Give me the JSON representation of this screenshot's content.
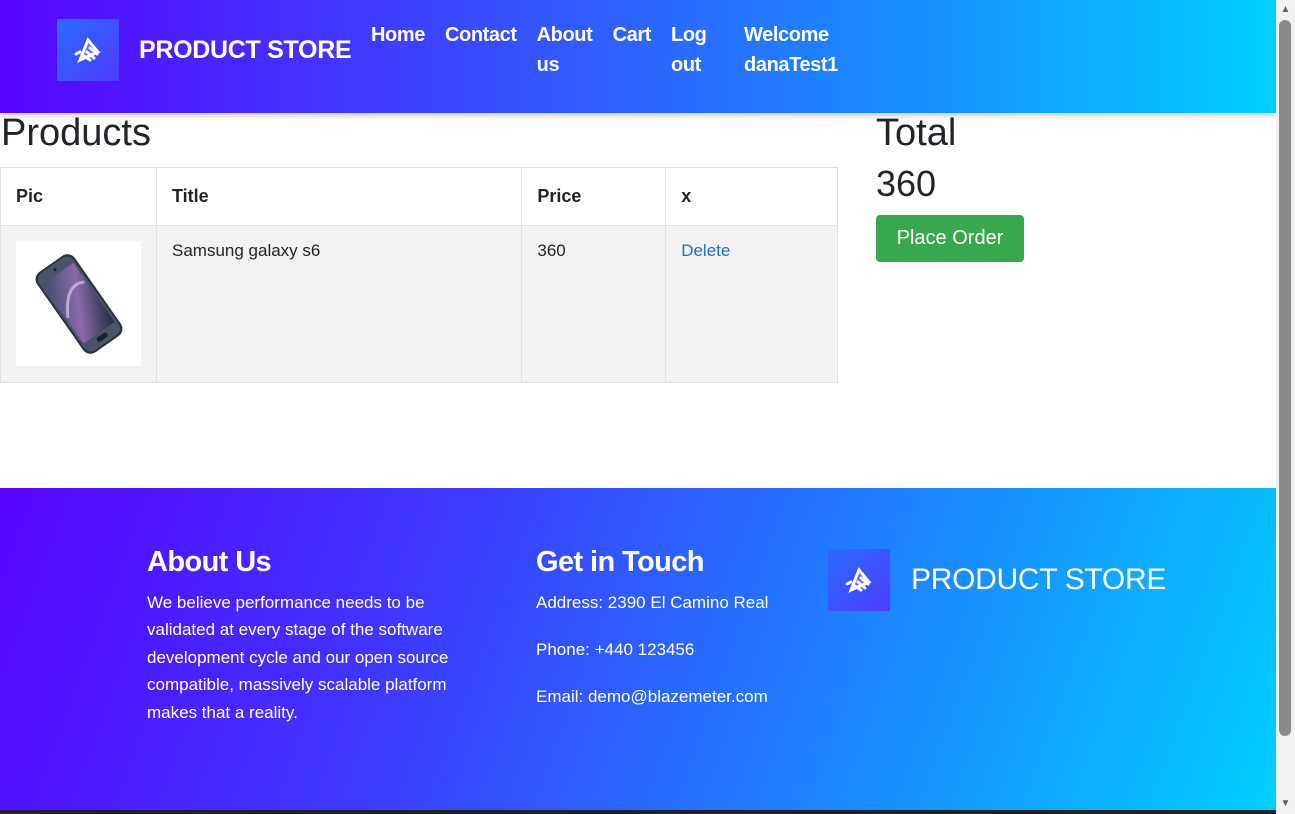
{
  "navbar": {
    "brand": "PRODUCT STORE",
    "links": {
      "home": "Home",
      "contact": "Contact",
      "about": "About us",
      "cart": "Cart",
      "logout": "Log out",
      "welcome": "Welcome danaTest1"
    }
  },
  "products": {
    "title": "Products",
    "headers": {
      "pic": "Pic",
      "title": "Title",
      "price": "Price",
      "x": "x"
    },
    "rows": [
      {
        "title": "Samsung galaxy s6",
        "price": "360",
        "action": "Delete",
        "image_icon": "phone-image"
      }
    ]
  },
  "total": {
    "label": "Total",
    "value": "360",
    "button": "Place Order"
  },
  "footer": {
    "about_title": "About Us",
    "about_text": "We believe performance needs to be validated at every stage of the software development cycle and our open source compatible, massively scalable platform makes that a reality.",
    "touch_title": "Get in Touch",
    "address": "Address: 2390 El Camino Real",
    "phone": "Phone: +440 123456",
    "email": "Email: demo@blazemeter.com",
    "brand": "PRODUCT STORE"
  },
  "colors": {
    "accent_green": "#37a84e",
    "link_blue": "#1a73c8",
    "gradient_start": "#5804ff",
    "gradient_end": "#00cfff"
  }
}
